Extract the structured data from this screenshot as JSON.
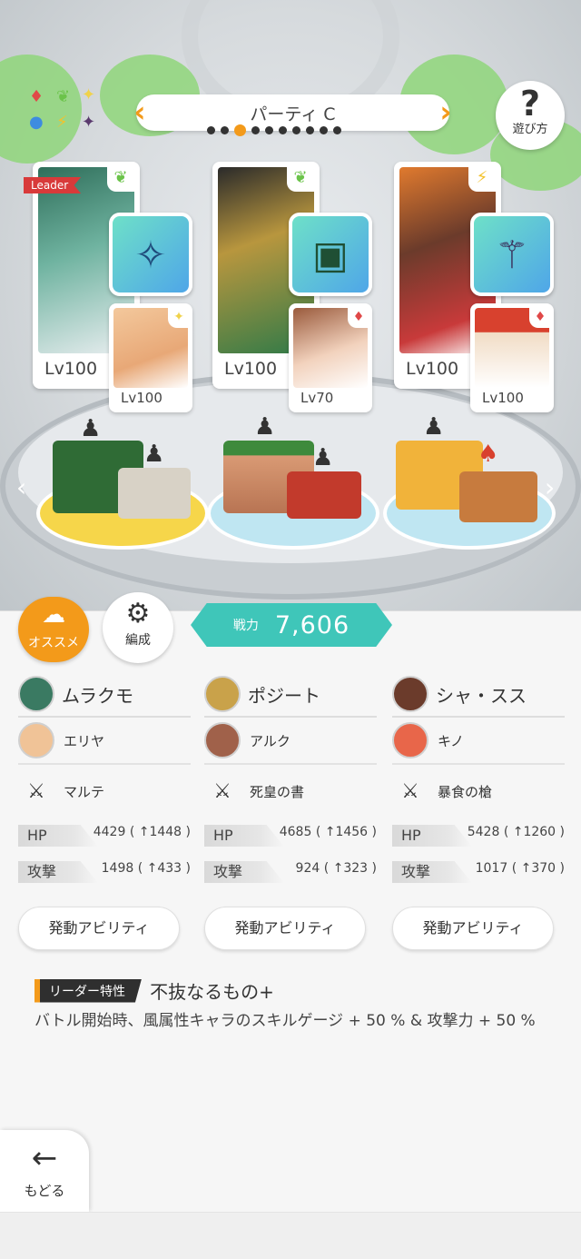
{
  "colors": {
    "accent": "#f39a1a",
    "power": "#3fc6b9",
    "leader_tag": "#d83a3a"
  },
  "header": {
    "party_title": "パーティ C",
    "page_count": 10,
    "active_page": 2,
    "help_label": "遊び方"
  },
  "element_icons": [
    "♦",
    "❦",
    "✦",
    "●",
    "⚡",
    "✦"
  ],
  "leader_badge": "Leader",
  "cards": [
    {
      "main_lv": "Lv100",
      "main_element": "❦",
      "weapon_icon": "✧",
      "sub_lv": "Lv100",
      "sub_element": "✦"
    },
    {
      "main_lv": "Lv100",
      "main_element": "❦",
      "weapon_icon": "▣",
      "sub_lv": "Lv70",
      "sub_element": "♦"
    },
    {
      "main_lv": "Lv100",
      "main_element": "⚡",
      "weapon_icon": "⚚",
      "sub_lv": "Lv100",
      "sub_element": "♦"
    }
  ],
  "buttons": {
    "recommend": "オススメ",
    "formation": "編成",
    "back": "もどる"
  },
  "power": {
    "label": "戦力",
    "value": "7,606"
  },
  "members": [
    {
      "main": "ムラクモ",
      "sub": "エリヤ",
      "weapon": "マルテ",
      "hp_label": "HP",
      "hp": "4429 ( ↑1448 )",
      "atk_label": "攻撃",
      "atk": "1498 ( ↑433 )",
      "ability": "発動アビリティ"
    },
    {
      "main": "ポジート",
      "sub": "アルク",
      "weapon": "死皇の書",
      "hp_label": "HP",
      "hp": "4685 ( ↑1456 )",
      "atk_label": "攻撃",
      "atk": "924 ( ↑323 )",
      "ability": "発動アビリティ"
    },
    {
      "main": "シャ・スス",
      "sub": "キノ",
      "weapon": "暴食の槍",
      "hp_label": "HP",
      "hp": "5428 ( ↑1260 )",
      "atk_label": "攻撃",
      "atk": "1017 ( ↑370 )",
      "ability": "発動アビリティ"
    }
  ],
  "leader_skill": {
    "tag": "リーダー特性",
    "name": "不抜なるもの+",
    "desc": "バトル開始時、風属性キャラのスキルゲージ + 50 % & 攻撃力 + 50 %"
  }
}
